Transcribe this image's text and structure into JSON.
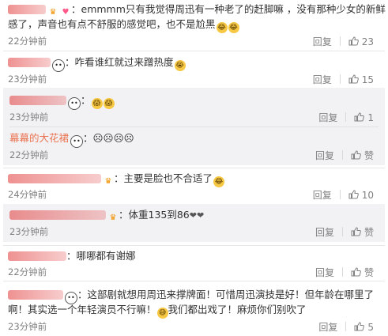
{
  "comments": [
    {
      "text_line1": "：emmmm只有我觉得周迅有一种老了的赶脚嘛 ，没有那种少女的新鲜",
      "text_line2": "感了，声音也有点不舒服的感觉吧，也不是尬黑",
      "time": "22分钟前",
      "reply": "回复",
      "likes": "23"
    },
    {
      "text": "：咋看谁红就过来蹭热度",
      "time": "23分钟前",
      "reply": "回复",
      "likes": "15",
      "sub_replies": [
        {
          "text": "：",
          "time": "23分钟前",
          "reply": "回复",
          "likes": "1"
        },
        {
          "username": "幕幕的大花裙",
          "text": "：☹☹☹☹",
          "time": "22分钟前",
          "reply": "回复",
          "likes": "赞"
        }
      ]
    },
    {
      "text": "：主要是脸也不合适了",
      "time": "24分钟前",
      "reply": "回复",
      "likes": "10",
      "sub_replies": [
        {
          "text": "：体重135到86",
          "time": "23分钟前",
          "reply": "回复",
          "likes": "赞"
        }
      ]
    },
    {
      "text": "：哪哪都有谢娜",
      "time": "22分钟前",
      "reply": "回复",
      "likes": "赞"
    },
    {
      "text_line1": "：这部剧就想用周迅来撑牌面！可惜周迅演技是好！但年龄在哪里了",
      "text_line2": "啊！其实选一个年轻演员不行嘛！",
      "text_line2b": "我们都出戏了！麻烦你们别吹了",
      "time": "23分钟前",
      "reply": "回复",
      "likes": "5"
    }
  ],
  "colors": {
    "username": "#eb7350",
    "muted": "#808080",
    "text": "#333333",
    "subbox_bg": "#f2f2f5"
  }
}
